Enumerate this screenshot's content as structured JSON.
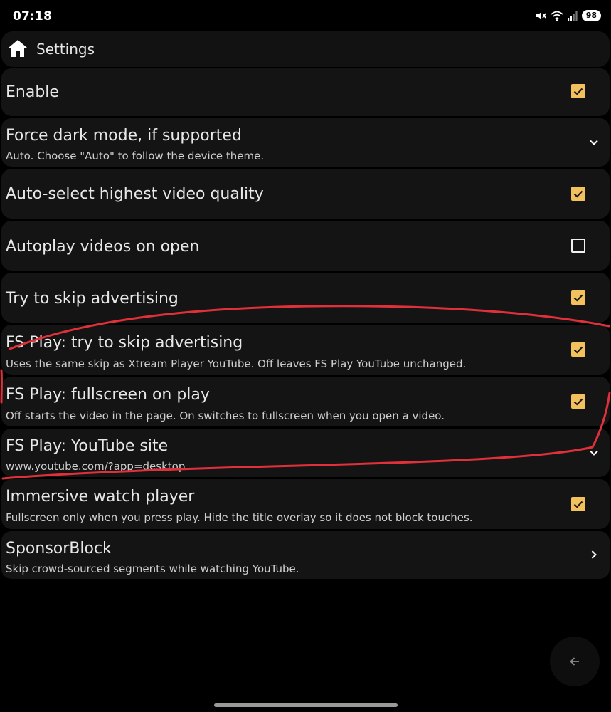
{
  "status_bar": {
    "time": "07:18",
    "battery": "98",
    "icons": [
      "mute-icon",
      "wifi-icon",
      "signal-icon",
      "battery-icon"
    ]
  },
  "header": {
    "title": "Settings",
    "icon": "home-icon"
  },
  "settings": [
    {
      "title": "Enable",
      "control": "checkbox",
      "checked": true
    },
    {
      "title": "Force dark mode, if supported",
      "subtitle": "Auto. Choose \"Auto\" to follow the device theme.",
      "control": "dropdown"
    },
    {
      "title": "Auto-select highest video quality",
      "control": "checkbox",
      "checked": true
    },
    {
      "title": "Autoplay videos on open",
      "control": "checkbox",
      "checked": false
    },
    {
      "title": "Try to skip advertising",
      "control": "checkbox",
      "checked": true
    },
    {
      "title": "FS Play: try to skip advertising",
      "subtitle": "Uses the same skip as Xtream Player YouTube. Off leaves FS Play YouTube unchanged.",
      "control": "checkbox",
      "checked": true
    },
    {
      "title": "FS Play: fullscreen on play",
      "subtitle": "Off starts the video in the page. On switches to fullscreen when you open a video.",
      "control": "checkbox",
      "checked": true
    },
    {
      "title": "FS Play: YouTube site",
      "subtitle": "www.youtube.com/?app=desktop",
      "control": "dropdown"
    },
    {
      "title": "Immersive watch player",
      "subtitle": "Fullscreen only when you press play. Hide the title overlay so it does not block touches.",
      "control": "checkbox",
      "checked": true
    },
    {
      "title": "SponsorBlock",
      "subtitle": "Skip crowd-sourced segments while watching YouTube.",
      "control": "chevron-right"
    }
  ],
  "fab": {
    "icon": "arrow-left-icon"
  },
  "colors": {
    "accent": "#f2c05c",
    "row_bg": "#141414",
    "annotation": "#e0303a"
  }
}
